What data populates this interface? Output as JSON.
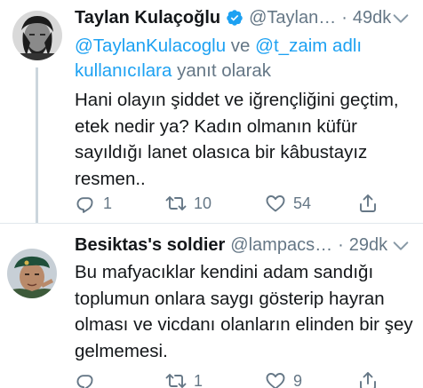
{
  "colors": {
    "link": "#1da1f2",
    "secondary": "#657786",
    "text": "#14171a",
    "divider": "#e1e8ed"
  },
  "tweets": [
    {
      "name": "Taylan Kulaçoğlu",
      "verified": true,
      "handle": "@Taylan…",
      "separator": "·",
      "time": "49dk",
      "reply_prefix": "@TaylanKulacoglu ve @t_zaim adlı",
      "reply_mention_1": "@TaylanKulacoglu",
      "reply_and": " ve ",
      "reply_mention_2": "@t_zaim adlı",
      "reply_users": "kullanıcılara",
      "reply_suffix": " yanıt olarak",
      "text": "Hani olayın şiddet ve iğrençliğini geçtim, etek nedir ya? Kadın olmanın küfür sayıldığı lanet olasıca bir kâbustayız resmen..",
      "replies": "1",
      "retweets": "10",
      "likes": "54",
      "avatar_icon": "man-portrait-avatar"
    },
    {
      "name": "Besiktas's soldier",
      "verified": false,
      "handle": "@lampacs…",
      "separator": "·",
      "time": "29dk",
      "text": "Bu mafyacıklar kendini adam sandığı toplumun onlara saygı gösterip hayran olması ve vicdanı olanların elinden bir şey gelmemesi.",
      "replies": "",
      "retweets": "1",
      "likes": "9",
      "avatar_icon": "soldier-beret-avatar"
    }
  ]
}
